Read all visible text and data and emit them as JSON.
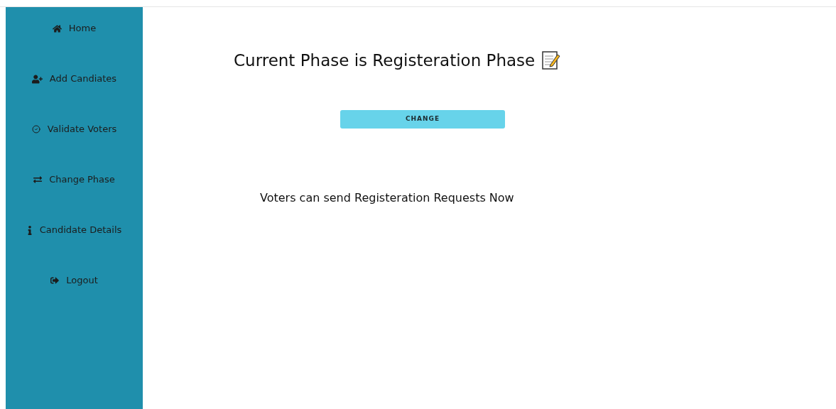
{
  "sidebar": {
    "items": [
      {
        "label": "Home"
      },
      {
        "label": "Add Candiates"
      },
      {
        "label": "Validate Voters"
      },
      {
        "label": "Change Phase"
      },
      {
        "label": "Candidate Details"
      },
      {
        "label": "Logout"
      }
    ]
  },
  "main": {
    "heading": "Current Phase is Registeration Phase",
    "button": "CHANGE",
    "message": "Voters can send Registeration Requests Now"
  }
}
